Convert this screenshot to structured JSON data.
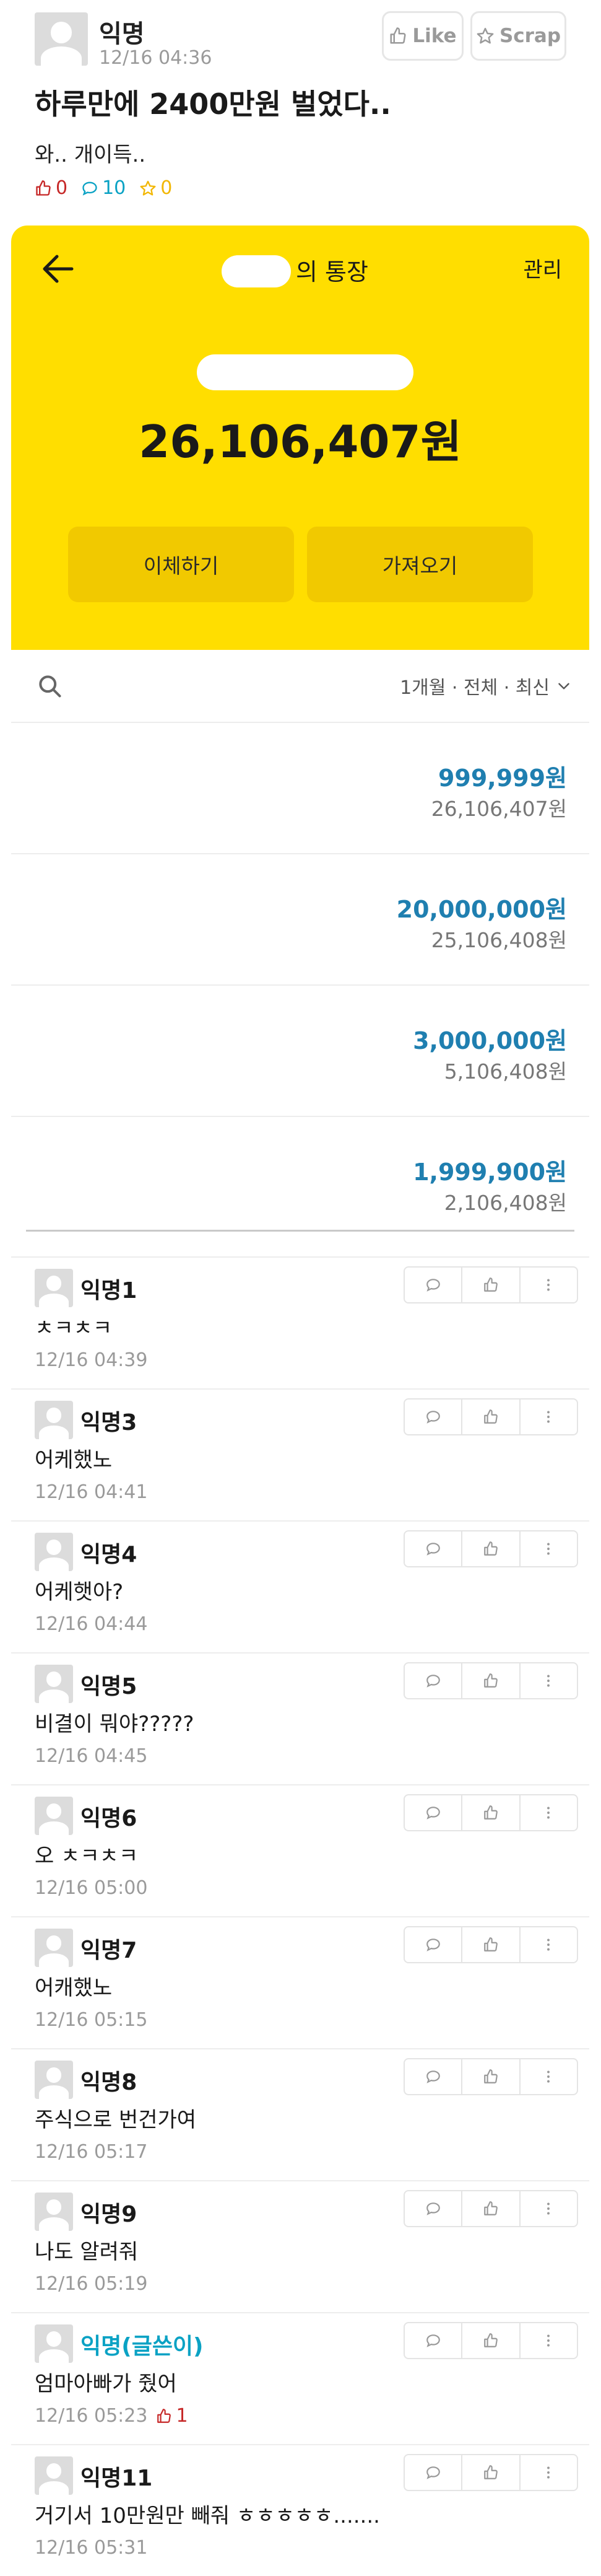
{
  "post": {
    "author": "익명",
    "time": "12/16 04:36",
    "like_label": "Like",
    "scrap_label": "Scrap",
    "title": "하루만에 2400만원 벌었다..",
    "body": "와.. 개이득..",
    "stats": {
      "likes": "0",
      "comments": "10",
      "scraps": "0"
    }
  },
  "bank": {
    "account_suffix": "의 통장",
    "manage_label": "관리",
    "balance": "26,106,407원",
    "transfer_label": "이체하기",
    "import_label": "가져오기",
    "filter_label": "1개월 · 전체 · 최신",
    "transactions": [
      {
        "amount": "999,999원",
        "balance": "26,106,407원"
      },
      {
        "amount": "20,000,000원",
        "balance": "25,106,408원"
      },
      {
        "amount": "3,000,000원",
        "balance": "5,106,408원"
      },
      {
        "amount": "1,999,900원",
        "balance": "2,106,408원"
      }
    ]
  },
  "comments": [
    {
      "author": "익명1",
      "text": "ㅊㅋㅊㅋ",
      "time": "12/16 04:39"
    },
    {
      "author": "익명3",
      "text": "어케했노",
      "time": "12/16 04:41"
    },
    {
      "author": "익명4",
      "text": "어케햇아?",
      "time": "12/16 04:44"
    },
    {
      "author": "익명5",
      "text": "비결이 뭐야?????",
      "time": "12/16 04:45"
    },
    {
      "author": "익명6",
      "text": "오 ㅊㅋㅊㅋ",
      "time": "12/16 05:00"
    },
    {
      "author": "익명7",
      "text": "어캐했노",
      "time": "12/16 05:15"
    },
    {
      "author": "익명8",
      "text": "주식으로 번건가여",
      "time": "12/16 05:17"
    },
    {
      "author": "익명9",
      "text": "나도 알려줘",
      "time": "12/16 05:19"
    },
    {
      "author": "익명(글쓴이)",
      "text": "엄마아빠가 줬어",
      "time": "12/16 05:23",
      "likes": "1"
    },
    {
      "author": "익명11",
      "text": "거기서 10만원만 빼줘 ㅎㅎㅎㅎㅎ.......",
      "time": "12/16 05:31"
    }
  ],
  "colors": {
    "bank_yellow": "#ffde00",
    "amount_blue": "#1f7fb0",
    "op_teal": "#0aa2c4",
    "like_red": "#c62828"
  }
}
